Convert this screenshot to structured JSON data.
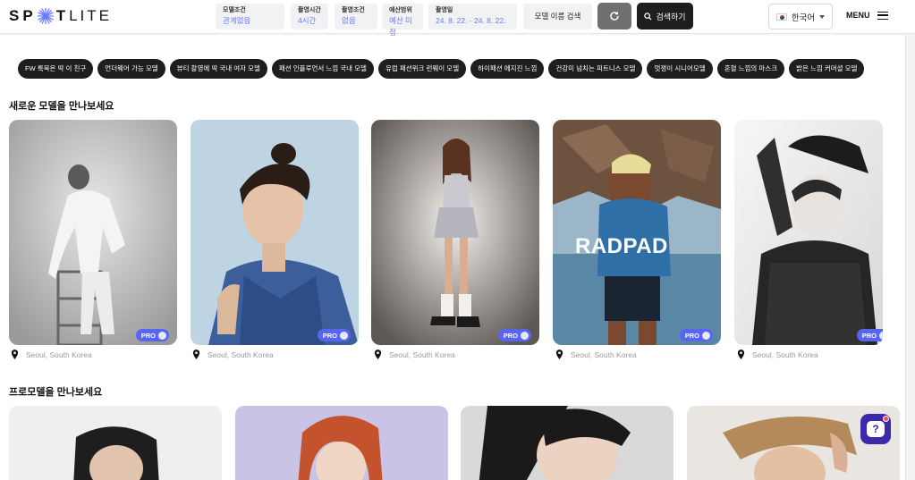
{
  "header": {
    "logo_left": "SP",
    "logo_right": "T",
    "logo_tail": "LITE",
    "filters": [
      {
        "label": "모델조건",
        "value": "관계없음"
      },
      {
        "label": "촬영시간",
        "value": "4시간"
      },
      {
        "label": "촬영조건",
        "value": "없음"
      },
      {
        "label": "예산범위",
        "value": "예산 미정"
      },
      {
        "label": "촬영일",
        "value": "24. 8. 22. - 24. 8. 22."
      }
    ],
    "name_search": "모델 이름 검색",
    "search_button": "검색하기",
    "language": "한국어",
    "menu": "MENU"
  },
  "tags": [
    "FW 룩북은 딱 이 친구",
    "언더웨어 가능 모델",
    "뷰티 촬영에 딱 국내 여자 모델",
    "패션 인플루언서 느낌 국내 모델",
    "유럽 패션위크 런웨이 모델",
    "하이패션 에지진 느낌",
    "건강미 넘치는 피트니스 모델",
    "멋쟁이 시니어모델",
    "혼혈 느낌의 마스크",
    "밝은 느낌 커머셜 모델"
  ],
  "sections": {
    "new_models": "새로운 모델을 만나보세요",
    "pro_models": "프로모델을 만나보세요"
  },
  "cards": [
    {
      "location": "Seoul, South Korea",
      "badge": "PRO"
    },
    {
      "location": "Seoul, South Korea",
      "badge": "PRO"
    },
    {
      "location": "Seoul, South Korea",
      "badge": "PRO"
    },
    {
      "location": "Seoul, South Korea",
      "badge": "PRO",
      "brand": "RADPAD"
    },
    {
      "location": "Seoul, South Korea",
      "badge": "PRO"
    }
  ],
  "help": "?",
  "colors": {
    "accent": "#5865f2",
    "filter_value": "#6b7cff",
    "dark_button": "#1e1e1e",
    "refresh_button": "#707070",
    "help_button": "#3b2ba8"
  }
}
